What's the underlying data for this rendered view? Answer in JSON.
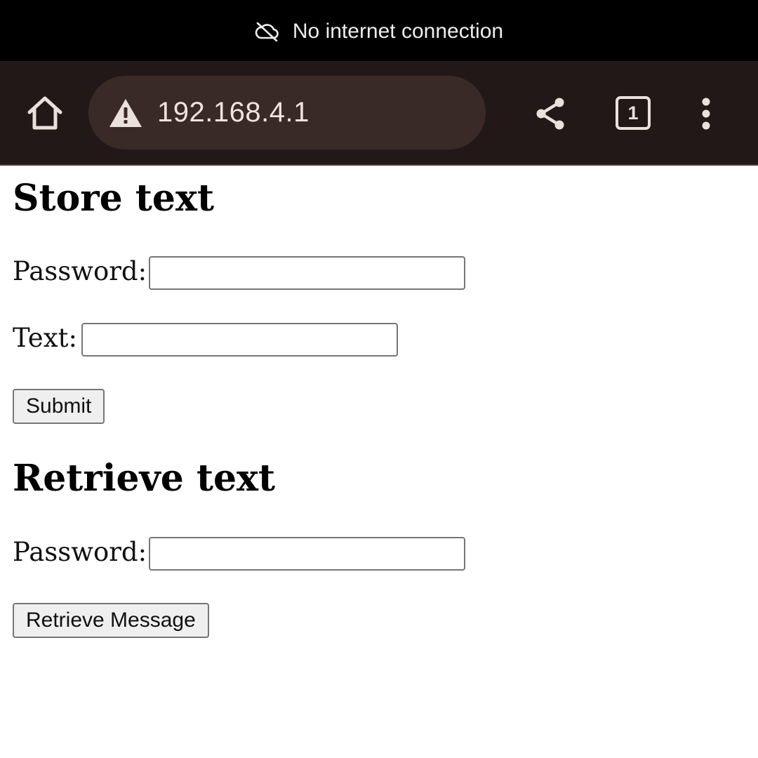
{
  "status_banner": {
    "icon": "cloud-off-icon",
    "text": "No internet connection"
  },
  "browser_toolbar": {
    "home_icon": "home-icon",
    "security_icon": "warning-triangle-icon",
    "url": "192.168.4.1",
    "share_icon": "share-icon",
    "tab_count": "1",
    "menu_icon": "more-vertical-icon",
    "colors": {
      "toolbar_bg": "#221817",
      "omnibox_bg": "#3a2a27",
      "icon_fg": "#ece0dd"
    }
  },
  "page": {
    "store": {
      "heading": "Store text",
      "password_label": "Password:",
      "password_value": "",
      "text_label": "Text:",
      "text_value": "",
      "submit_label": "Submit"
    },
    "retrieve": {
      "heading": "Retrieve text",
      "password_label": "Password:",
      "password_value": "",
      "button_label": "Retrieve Message"
    }
  }
}
